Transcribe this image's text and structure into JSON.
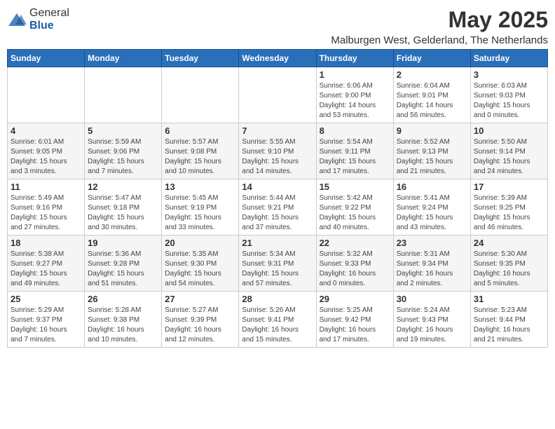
{
  "logo": {
    "general": "General",
    "blue": "Blue"
  },
  "title": "May 2025",
  "location": "Malburgen West, Gelderland, The Netherlands",
  "weekdays": [
    "Sunday",
    "Monday",
    "Tuesday",
    "Wednesday",
    "Thursday",
    "Friday",
    "Saturday"
  ],
  "weeks": [
    [
      {
        "day": "",
        "info": ""
      },
      {
        "day": "",
        "info": ""
      },
      {
        "day": "",
        "info": ""
      },
      {
        "day": "",
        "info": ""
      },
      {
        "day": "1",
        "info": "Sunrise: 6:06 AM\nSunset: 9:00 PM\nDaylight: 14 hours\nand 53 minutes."
      },
      {
        "day": "2",
        "info": "Sunrise: 6:04 AM\nSunset: 9:01 PM\nDaylight: 14 hours\nand 56 minutes."
      },
      {
        "day": "3",
        "info": "Sunrise: 6:03 AM\nSunset: 9:03 PM\nDaylight: 15 hours\nand 0 minutes."
      }
    ],
    [
      {
        "day": "4",
        "info": "Sunrise: 6:01 AM\nSunset: 9:05 PM\nDaylight: 15 hours\nand 3 minutes."
      },
      {
        "day": "5",
        "info": "Sunrise: 5:59 AM\nSunset: 9:06 PM\nDaylight: 15 hours\nand 7 minutes."
      },
      {
        "day": "6",
        "info": "Sunrise: 5:57 AM\nSunset: 9:08 PM\nDaylight: 15 hours\nand 10 minutes."
      },
      {
        "day": "7",
        "info": "Sunrise: 5:55 AM\nSunset: 9:10 PM\nDaylight: 15 hours\nand 14 minutes."
      },
      {
        "day": "8",
        "info": "Sunrise: 5:54 AM\nSunset: 9:11 PM\nDaylight: 15 hours\nand 17 minutes."
      },
      {
        "day": "9",
        "info": "Sunrise: 5:52 AM\nSunset: 9:13 PM\nDaylight: 15 hours\nand 21 minutes."
      },
      {
        "day": "10",
        "info": "Sunrise: 5:50 AM\nSunset: 9:14 PM\nDaylight: 15 hours\nand 24 minutes."
      }
    ],
    [
      {
        "day": "11",
        "info": "Sunrise: 5:49 AM\nSunset: 9:16 PM\nDaylight: 15 hours\nand 27 minutes."
      },
      {
        "day": "12",
        "info": "Sunrise: 5:47 AM\nSunset: 9:18 PM\nDaylight: 15 hours\nand 30 minutes."
      },
      {
        "day": "13",
        "info": "Sunrise: 5:45 AM\nSunset: 9:19 PM\nDaylight: 15 hours\nand 33 minutes."
      },
      {
        "day": "14",
        "info": "Sunrise: 5:44 AM\nSunset: 9:21 PM\nDaylight: 15 hours\nand 37 minutes."
      },
      {
        "day": "15",
        "info": "Sunrise: 5:42 AM\nSunset: 9:22 PM\nDaylight: 15 hours\nand 40 minutes."
      },
      {
        "day": "16",
        "info": "Sunrise: 5:41 AM\nSunset: 9:24 PM\nDaylight: 15 hours\nand 43 minutes."
      },
      {
        "day": "17",
        "info": "Sunrise: 5:39 AM\nSunset: 9:25 PM\nDaylight: 15 hours\nand 46 minutes."
      }
    ],
    [
      {
        "day": "18",
        "info": "Sunrise: 5:38 AM\nSunset: 9:27 PM\nDaylight: 15 hours\nand 49 minutes."
      },
      {
        "day": "19",
        "info": "Sunrise: 5:36 AM\nSunset: 9:28 PM\nDaylight: 15 hours\nand 51 minutes."
      },
      {
        "day": "20",
        "info": "Sunrise: 5:35 AM\nSunset: 9:30 PM\nDaylight: 15 hours\nand 54 minutes."
      },
      {
        "day": "21",
        "info": "Sunrise: 5:34 AM\nSunset: 9:31 PM\nDaylight: 15 hours\nand 57 minutes."
      },
      {
        "day": "22",
        "info": "Sunrise: 5:32 AM\nSunset: 9:33 PM\nDaylight: 16 hours\nand 0 minutes."
      },
      {
        "day": "23",
        "info": "Sunrise: 5:31 AM\nSunset: 9:34 PM\nDaylight: 16 hours\nand 2 minutes."
      },
      {
        "day": "24",
        "info": "Sunrise: 5:30 AM\nSunset: 9:35 PM\nDaylight: 16 hours\nand 5 minutes."
      }
    ],
    [
      {
        "day": "25",
        "info": "Sunrise: 5:29 AM\nSunset: 9:37 PM\nDaylight: 16 hours\nand 7 minutes."
      },
      {
        "day": "26",
        "info": "Sunrise: 5:28 AM\nSunset: 9:38 PM\nDaylight: 16 hours\nand 10 minutes."
      },
      {
        "day": "27",
        "info": "Sunrise: 5:27 AM\nSunset: 9:39 PM\nDaylight: 16 hours\nand 12 minutes."
      },
      {
        "day": "28",
        "info": "Sunrise: 5:26 AM\nSunset: 9:41 PM\nDaylight: 16 hours\nand 15 minutes."
      },
      {
        "day": "29",
        "info": "Sunrise: 5:25 AM\nSunset: 9:42 PM\nDaylight: 16 hours\nand 17 minutes."
      },
      {
        "day": "30",
        "info": "Sunrise: 5:24 AM\nSunset: 9:43 PM\nDaylight: 16 hours\nand 19 minutes."
      },
      {
        "day": "31",
        "info": "Sunrise: 5:23 AM\nSunset: 9:44 PM\nDaylight: 16 hours\nand 21 minutes."
      }
    ]
  ]
}
